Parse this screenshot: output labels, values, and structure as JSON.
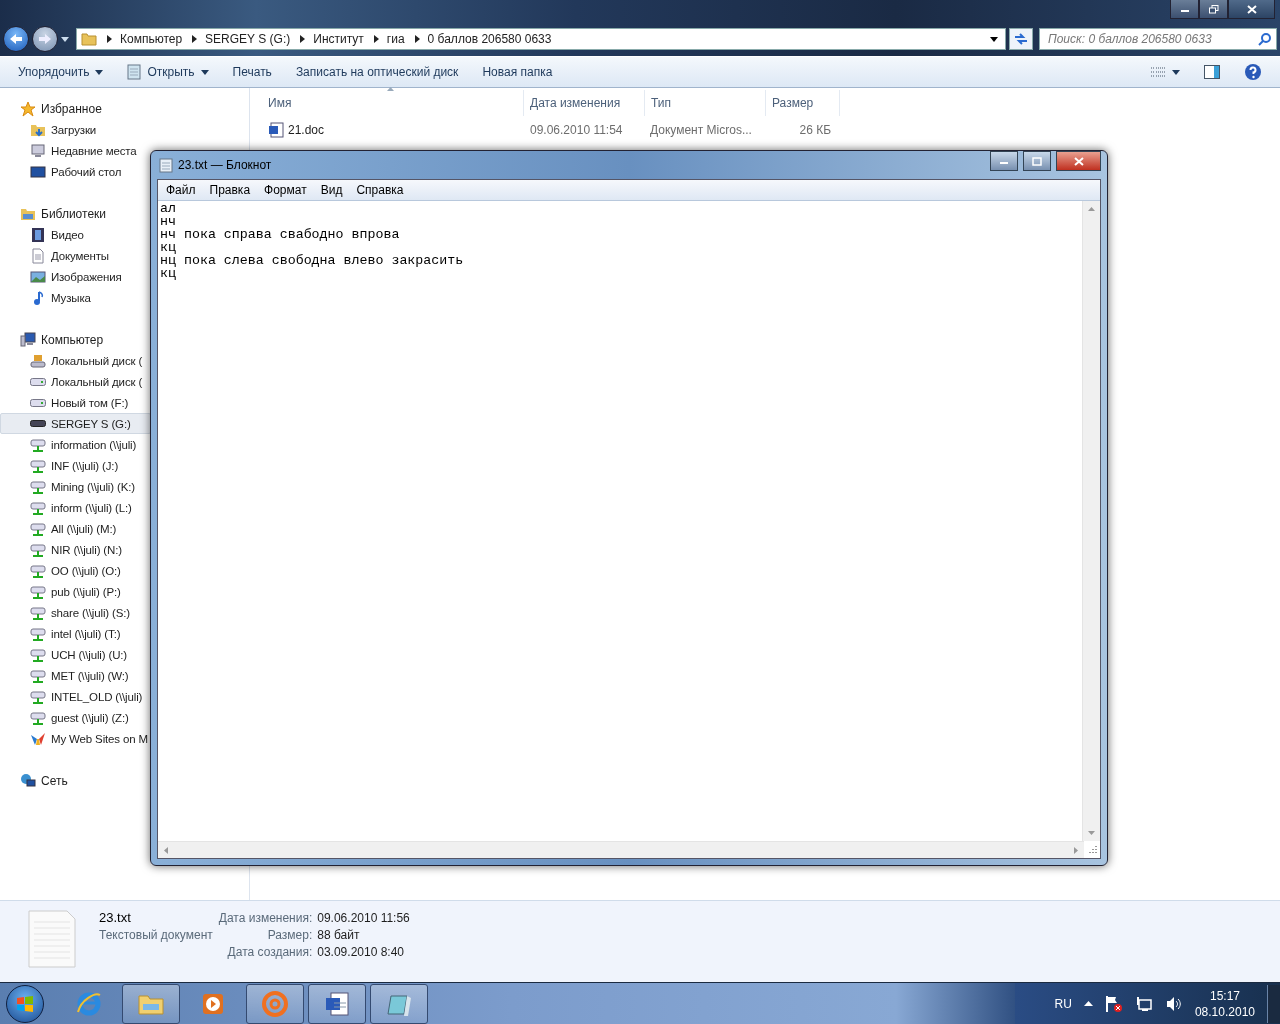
{
  "explorer": {
    "address": {
      "crumbs": [
        "Компьютер",
        "SERGEY S (G:)",
        "Институт",
        "гиа",
        "0 баллов 206580 0633"
      ]
    },
    "search": {
      "placeholder": "Поиск: 0 баллов 206580 0633"
    },
    "toolbar": [
      {
        "label": "Упорядочить",
        "kind": "menu"
      },
      {
        "label": "Открыть",
        "kind": "open"
      },
      {
        "label": "Печать",
        "kind": "plain"
      },
      {
        "label": "Записать на оптический диск",
        "kind": "plain"
      },
      {
        "label": "Новая папка",
        "kind": "plain"
      }
    ],
    "sidebar": [
      {
        "label": "Избранное",
        "kind": "star",
        "children": [
          {
            "label": "Загрузки",
            "kind": "downloads",
            "selected": false
          },
          {
            "label": "Недавние места",
            "kind": "recent",
            "selected": false
          },
          {
            "label": "Рабочий стол",
            "kind": "desktop",
            "selected": false
          }
        ]
      },
      {
        "label": "Библиотеки",
        "kind": "library",
        "children": [
          {
            "label": "Видео",
            "kind": "video",
            "selected": false
          },
          {
            "label": "Документы",
            "kind": "document",
            "selected": false
          },
          {
            "label": "Изображения",
            "kind": "image",
            "selected": false
          },
          {
            "label": "Музыка",
            "kind": "music",
            "selected": false
          }
        ]
      },
      {
        "label": "Компьютер",
        "kind": "computer",
        "children": [
          {
            "label": "Локальный диск (",
            "kind": "sysdrive",
            "selected": false
          },
          {
            "label": "Локальный диск (",
            "kind": "drive",
            "selected": false
          },
          {
            "label": "Новый том (F:)",
            "kind": "drive",
            "selected": false
          },
          {
            "label": "SERGEY S (G:)",
            "kind": "usb",
            "selected": true
          },
          {
            "label": "information (\\\\juli)",
            "kind": "network",
            "selected": false
          },
          {
            "label": "INF (\\\\juli) (J:)",
            "kind": "network",
            "selected": false
          },
          {
            "label": "Mining (\\\\juli) (K:)",
            "kind": "network",
            "selected": false
          },
          {
            "label": "inform (\\\\juli) (L:)",
            "kind": "network",
            "selected": false
          },
          {
            "label": "All (\\\\juli) (M:)",
            "kind": "network",
            "selected": false
          },
          {
            "label": "NIR (\\\\juli) (N:)",
            "kind": "network",
            "selected": false
          },
          {
            "label": "OO (\\\\juli) (O:)",
            "kind": "network",
            "selected": false
          },
          {
            "label": "pub (\\\\juli) (P:)",
            "kind": "network",
            "selected": false
          },
          {
            "label": "share (\\\\juli) (S:)",
            "kind": "network",
            "selected": false
          },
          {
            "label": "intel (\\\\juli) (T:)",
            "kind": "network",
            "selected": false
          },
          {
            "label": "UCH (\\\\juli) (U:)",
            "kind": "network",
            "selected": false
          },
          {
            "label": "MET (\\\\juli) (W:)",
            "kind": "network",
            "selected": false
          },
          {
            "label": "INTEL_OLD (\\\\juli)",
            "kind": "network",
            "selected": false
          },
          {
            "label": "guest (\\\\juli) (Z:)",
            "kind": "network",
            "selected": false
          },
          {
            "label": "My Web Sites on M",
            "kind": "web",
            "selected": false
          }
        ]
      },
      {
        "label": "Сеть",
        "kind": "net"
      }
    ],
    "columns": [
      {
        "label": "Имя",
        "sorted": true
      },
      {
        "label": "Дата изменения",
        "sorted": false
      },
      {
        "label": "Тип",
        "sorted": false
      },
      {
        "label": "Размер",
        "sorted": false
      }
    ],
    "rows": [
      {
        "name": "21.doc",
        "date": "09.06.2010 11:54",
        "type": "Документ Micros...",
        "size": "26 КБ"
      }
    ],
    "details": {
      "name": "23.txt",
      "type": "Текстовый документ",
      "props": [
        {
          "label": "Дата изменения:",
          "value": "09.06.2010 11:56"
        },
        {
          "label": "Размер:",
          "value": "88 байт"
        },
        {
          "label": "Дата создания:",
          "value": "03.09.2010 8:40"
        }
      ]
    }
  },
  "notepad": {
    "title": "23.txt — Блокнот",
    "menu": [
      "Файл",
      "Правка",
      "Формат",
      "Вид",
      "Справка"
    ],
    "lines": [
      "ал",
      "нч",
      "нч пока справа свабодно впрова",
      "кц",
      "нц пока слева свободна влево закрасить",
      "кц"
    ]
  },
  "taskbar": {
    "apps": [
      {
        "kind": "browser",
        "open": false
      },
      {
        "kind": "folder",
        "open": true
      },
      {
        "kind": "media",
        "open": false
      },
      {
        "kind": "mail",
        "open": true
      },
      {
        "kind": "word",
        "open": true
      },
      {
        "kind": "notepad",
        "open": true
      }
    ],
    "language": "RU",
    "time": "15:17",
    "date": "08.10.2010"
  }
}
